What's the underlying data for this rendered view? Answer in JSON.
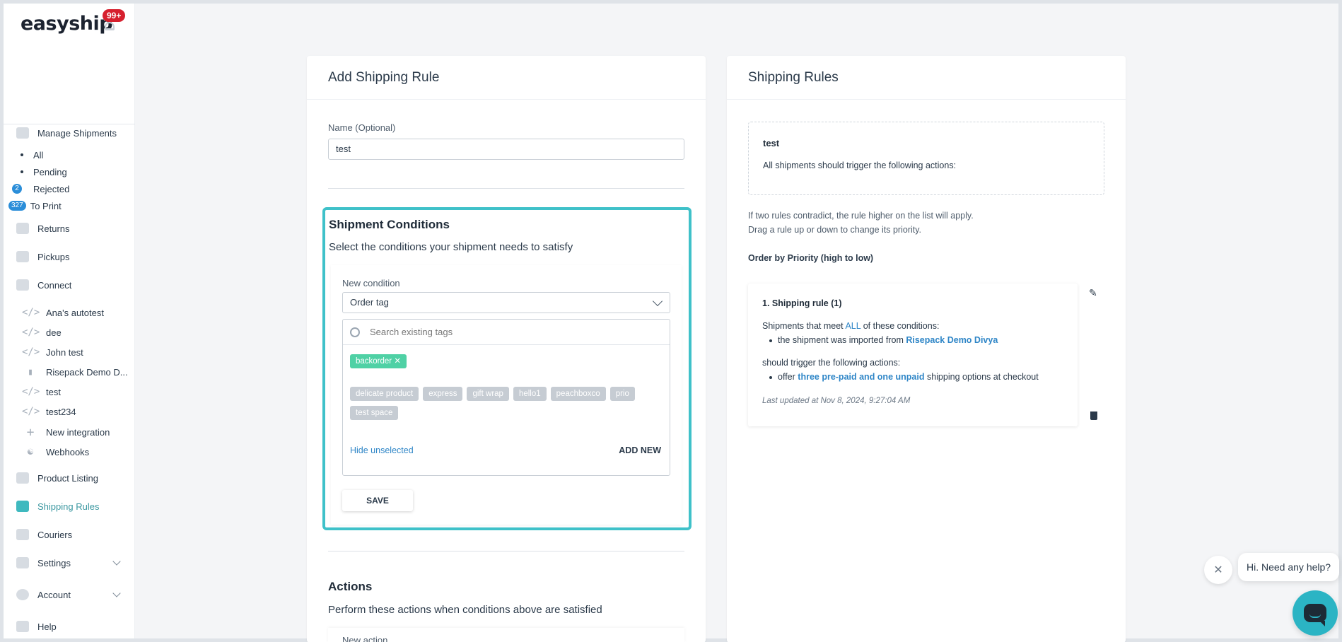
{
  "brand": {
    "logo_text": "easyship",
    "notifications_badge": "99+"
  },
  "sidebar": {
    "manage_shipments": "Manage Shipments",
    "shipment_filters": [
      {
        "label": "All",
        "badge": ""
      },
      {
        "label": "Pending",
        "badge": ""
      },
      {
        "label": "Rejected",
        "badge": "2"
      },
      {
        "label": "To Print",
        "badge": "327"
      }
    ],
    "returns": "Returns",
    "pickups": "Pickups",
    "connect": "Connect",
    "integrations": [
      "Ana's autotest",
      "dee",
      "John test",
      "Risepack Demo D...",
      "test",
      "test234"
    ],
    "new_integration": "New integration",
    "webhooks": "Webhooks",
    "product_listing": "Product Listing",
    "shipping_rules": "Shipping Rules",
    "couriers": "Couriers",
    "settings": "Settings",
    "account": "Account",
    "help": "Help"
  },
  "add_rule": {
    "title": "Add Shipping Rule",
    "name_label": "Name (Optional)",
    "name_value": "test",
    "conditions": {
      "title": "Shipment Conditions",
      "subtitle": "Select the conditions your shipment needs to satisfy",
      "new_condition_label": "New condition",
      "condition_value": "Order tag",
      "search_placeholder": "Search existing tags",
      "selected_tag": "backorder",
      "tags": [
        "delicate product",
        "express",
        "gift wrap",
        "hello1",
        "peachboxco",
        "prio",
        "test space"
      ],
      "hide_unselected": "Hide unselected",
      "add_new": "ADD NEW",
      "save": "SAVE"
    },
    "actions": {
      "title": "Actions",
      "subtitle": "Perform these actions when conditions above are satisfied",
      "new_action_label": "New action"
    }
  },
  "shipping_rules": {
    "title": "Shipping Rules",
    "preview_name": "test",
    "preview_text": "All shipments should trigger the following actions:",
    "help_line1": "If two rules contradict, the rule higher on the list will apply.",
    "help_line2": "Drag a rule up or down to change its priority.",
    "order_label": "Order by Priority (high to low)",
    "rule": {
      "title": "1. Shipping rule (1)",
      "meet_prefix": "Shipments that meet",
      "meet_all": "ALL",
      "meet_suffix": "of these conditions:",
      "condition_prefix": "the shipment was imported from",
      "condition_store": "Risepack Demo Divya",
      "trigger_text": "should trigger the following actions:",
      "action_prefix": "offer",
      "action_bold": "three pre-paid and one unpaid",
      "action_suffix": "shipping options at checkout",
      "updated": "Last updated at Nov 8, 2024, 9:27:04 AM"
    }
  },
  "chat": {
    "greeting": "Hi. Need any help?"
  },
  "colors": {
    "accent": "#3fc1c9",
    "link": "#2f86c7",
    "selected_tag": "#4fd1a5",
    "badge_red": "#d6202e"
  }
}
